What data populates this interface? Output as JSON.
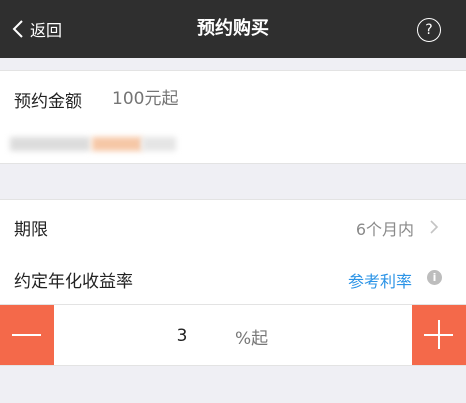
{
  "header": {
    "back_label": "返回",
    "title": "预约购买",
    "help_glyph": "?"
  },
  "amount": {
    "label": "预约金额",
    "placeholder": "100元起"
  },
  "period": {
    "label": "期限",
    "value": "6个月内"
  },
  "rate": {
    "label": "约定年化收益率",
    "link": "参考利率",
    "info_glyph": "i"
  },
  "stepper": {
    "value": "3",
    "suffix": "%起"
  },
  "colors": {
    "header_bg": "#2f2f2f",
    "accent": "#f4694a",
    "link": "#2a93e6"
  }
}
